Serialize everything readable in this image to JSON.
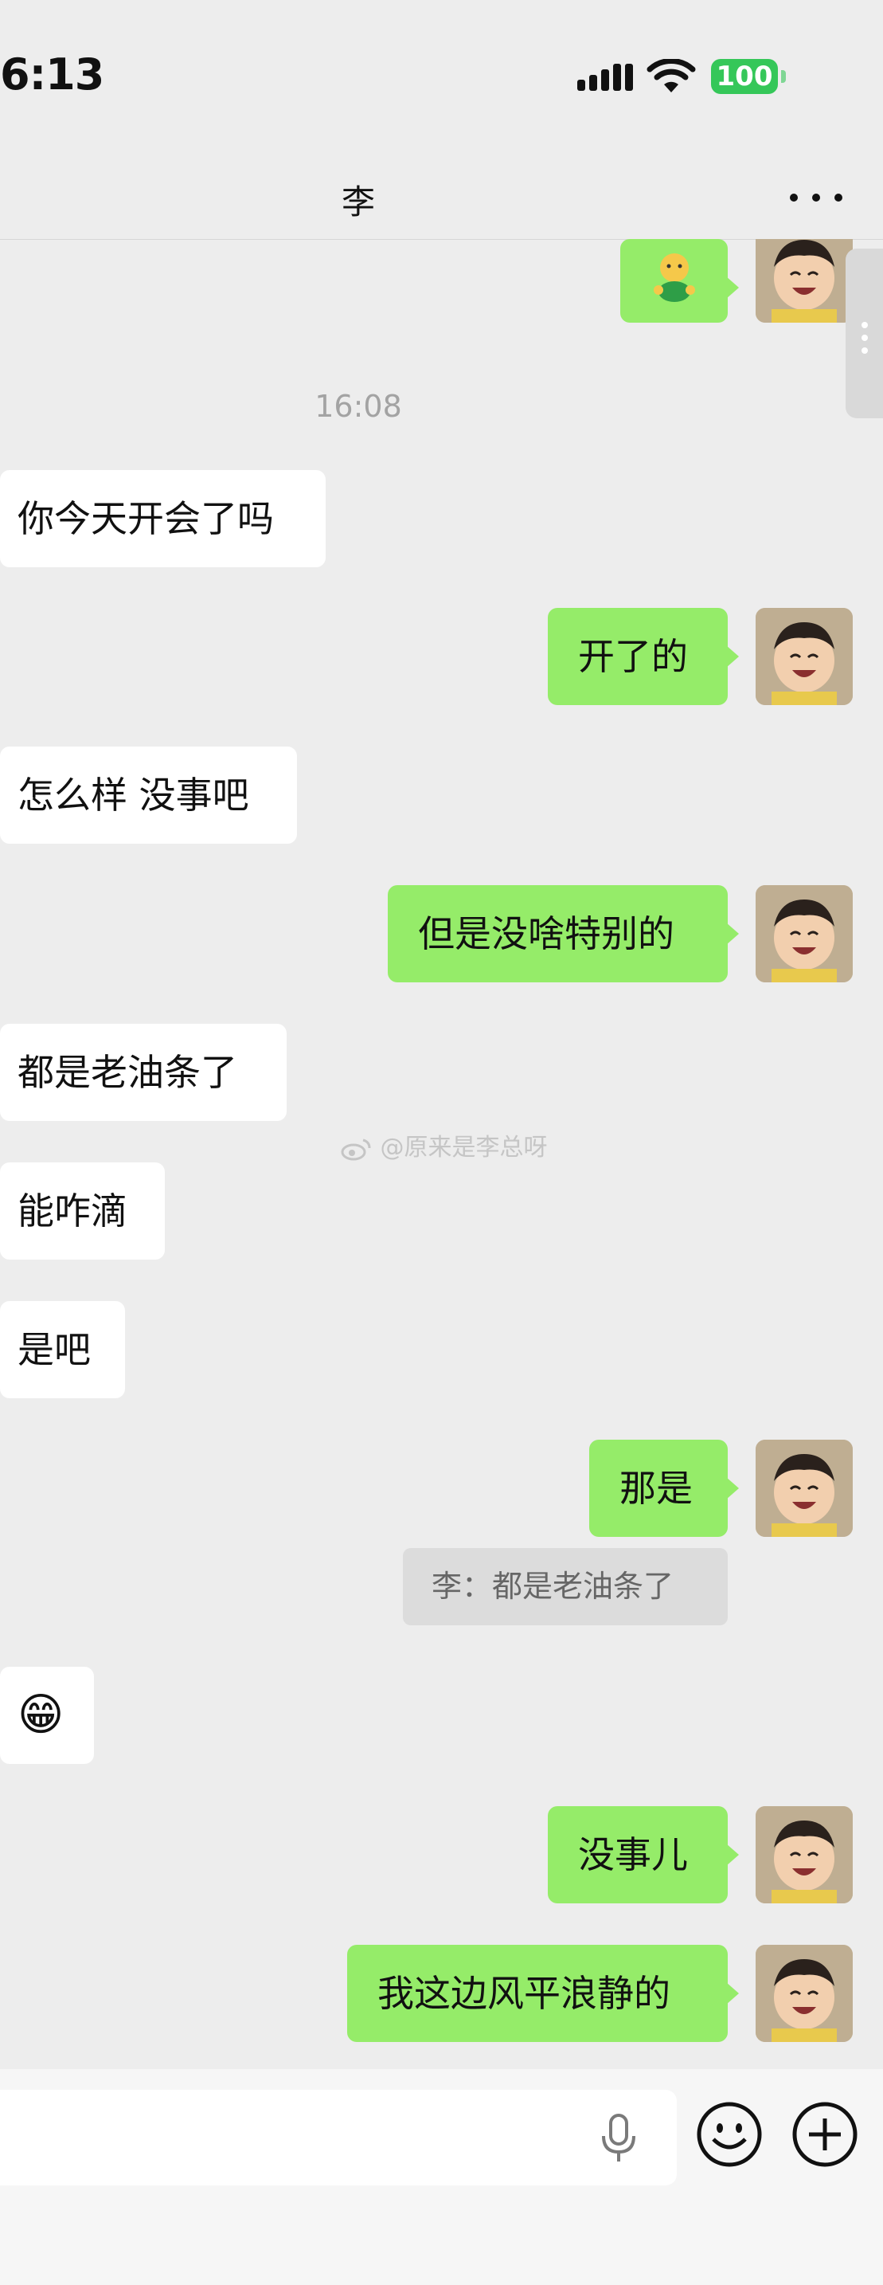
{
  "status_bar": {
    "time": "6:13",
    "battery": "100"
  },
  "nav": {
    "title": "李"
  },
  "timestamp": "16:08",
  "messages": {
    "m1": "你今天开会了吗",
    "m2": "开了的",
    "m3": "怎么样 没事吧",
    "m4": "但是没啥特别的",
    "m5": "都是老油条了",
    "m6": "能咋滴",
    "m7": "是吧",
    "m8": "那是",
    "m9": "😁",
    "m10": "没事儿",
    "m11": "我这边风平浪静的"
  },
  "quote": "李：都是老油条了",
  "watermark": "@原来是李总呀",
  "input": {
    "placeholder": ""
  },
  "colors": {
    "sent_bubble": "#95ec69",
    "received_bubble": "#ffffff",
    "background": "#ededed"
  }
}
